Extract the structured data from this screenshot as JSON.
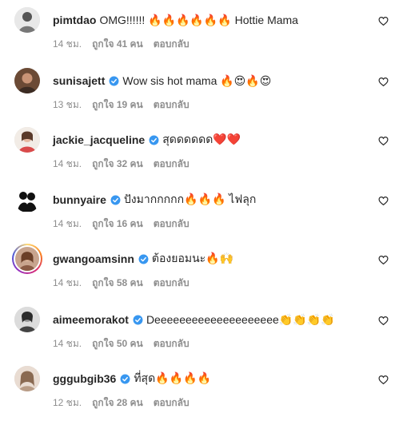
{
  "colors": {
    "text": "#262626",
    "meta": "#8e8e8e",
    "verified": "#3897f0"
  },
  "comments": [
    {
      "username": "pimtdao",
      "verified": false,
      "text": "OMG!!!!!! 🔥🔥🔥🔥🔥🔥 Hottie Mama",
      "time": "14 ชม.",
      "likes": "ถูกใจ 41 คน",
      "reply": "ตอบกลับ"
    },
    {
      "username": "sunisajett",
      "verified": true,
      "text": "Wow sis hot mama 🔥😍🔥😍",
      "time": "13 ชม.",
      "likes": "ถูกใจ 19 คน",
      "reply": "ตอบกลับ"
    },
    {
      "username": "jackie_jacqueline",
      "verified": true,
      "text": "สุดดดดดด❤️❤️",
      "time": "14 ชม.",
      "likes": "ถูกใจ 32 คน",
      "reply": "ตอบกลับ"
    },
    {
      "username": "bunnyaire",
      "verified": true,
      "text": "ปังมากกกกก🔥🔥🔥 ไฟลุก",
      "time": "14 ชม.",
      "likes": "ถูกใจ 16 คน",
      "reply": "ตอบกลับ"
    },
    {
      "username": "gwangoamsinn",
      "verified": true,
      "text": "ต้องยอมนะ🔥🙌",
      "time": "14 ชม.",
      "likes": "ถูกใจ 58 คน",
      "reply": "ตอบกลับ"
    },
    {
      "username": "aimeemorakot",
      "verified": true,
      "text": "Deeeeeeeeeeeeeeeeeeee👏👏👏👏",
      "time": "14 ชม.",
      "likes": "ถูกใจ 50 คน",
      "reply": "ตอบกลับ"
    },
    {
      "username": "gggubgib36",
      "verified": true,
      "text": "ที่สุด🔥🔥🔥🔥",
      "time": "12 ชม.",
      "likes": "ถูกใจ 28 คน",
      "reply": "ตอบกลับ"
    }
  ]
}
